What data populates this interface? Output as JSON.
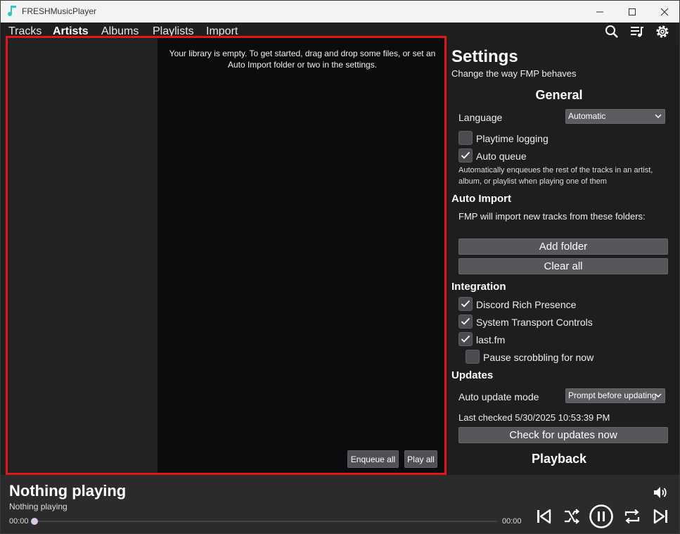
{
  "window": {
    "title": "FRESHMusicPlayer"
  },
  "nav": {
    "tabs": [
      "Tracks",
      "Artists",
      "Albums",
      "Playlists",
      "Import"
    ],
    "active": "Artists"
  },
  "library": {
    "empty_message": "Your library is empty. To get started, drag and drop some files, or set an Auto Import folder or two in the settings.",
    "enqueue_all": "Enqueue all",
    "play_all": "Play all"
  },
  "settings": {
    "title": "Settings",
    "subtitle": "Change the way FMP behaves",
    "general": {
      "heading": "General",
      "language_label": "Language",
      "language_value": "Automatic",
      "playtime_logging": "Playtime logging",
      "playtime_logging_checked": false,
      "auto_queue": "Auto queue",
      "auto_queue_checked": true,
      "auto_queue_desc": "Automatically enqueues the rest of the tracks in an artist, album, or playlist when playing one of them"
    },
    "auto_import": {
      "heading": "Auto Import",
      "desc": "FMP will import new tracks from these folders:",
      "add_folder": "Add folder",
      "clear_all": "Clear all"
    },
    "integration": {
      "heading": "Integration",
      "discord": "Discord Rich Presence",
      "discord_checked": true,
      "smtc": "System Transport Controls",
      "smtc_checked": true,
      "lastfm": "last.fm",
      "lastfm_checked": true,
      "pause_scrobbling": "Pause scrobbling for now",
      "pause_scrobbling_checked": false
    },
    "updates": {
      "heading": "Updates",
      "mode_label": "Auto update mode",
      "mode_value": "Prompt before updating",
      "last_checked": "Last checked 5/30/2025 10:53:39 PM",
      "check_now": "Check for updates now"
    },
    "playback": {
      "heading": "Playback"
    }
  },
  "player": {
    "title": "Nothing playing",
    "subtitle": "Nothing playing",
    "elapsed": "00:00",
    "total": "00:00",
    "progress": 0
  },
  "colors": {
    "accent_border": "#e0181b",
    "seek_knob": "#d9c7e6",
    "app_icon": "#2ec4c4"
  }
}
